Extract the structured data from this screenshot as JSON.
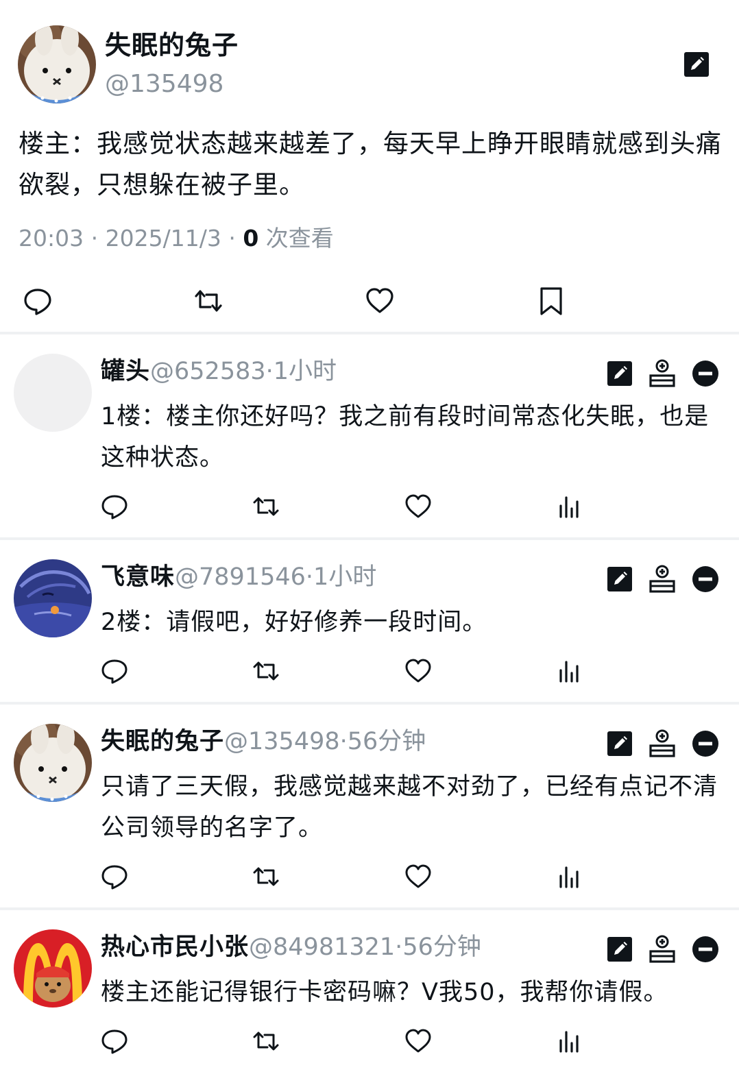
{
  "post": {
    "name": "失眠的兔子",
    "handle": "@135498",
    "text": "楼主：我感觉状态越来越差了，每天早上睁开眼睛就感到头痛欲裂，只想躲在被子里。",
    "time": "20:03",
    "date": "2025/11/3",
    "views_count": "0",
    "views_label": "次查看",
    "icons": {
      "edit": "edit-icon",
      "reply": "reply-icon",
      "retweet": "retweet-icon",
      "like": "heart-icon",
      "bookmark": "bookmark-icon"
    }
  },
  "replies": [
    {
      "name": "罐头",
      "handle": "@652583",
      "time": "1小时",
      "text": "1楼：楼主你还好吗？我之前有段时间常态化失眠，也是这种状态。",
      "avatar": "blank-avatar"
    },
    {
      "name": "飞意味",
      "handle": "@7891546",
      "time": "1小时",
      "text": "2楼：请假吧，好好修养一段时间。",
      "avatar": "dark-blue-avatar"
    },
    {
      "name": "失眠的兔子",
      "handle": "@135498",
      "time": "56分钟",
      "text": "只请了三天假，我感觉越来越不对劲了，已经有点记不清公司领导的名字了。",
      "avatar": "bunny-avatar"
    },
    {
      "name": "热心市民小张",
      "handle": "@84981321",
      "time": "56分钟",
      "text": "楼主还能记得银行卡密码嘛？V我50，我帮你请假。",
      "avatar": "mcdonalds-avatar"
    }
  ],
  "separator": "·",
  "colors": {
    "text": "#0f1419",
    "muted": "#8a939c",
    "divider": "#eff1f3"
  }
}
